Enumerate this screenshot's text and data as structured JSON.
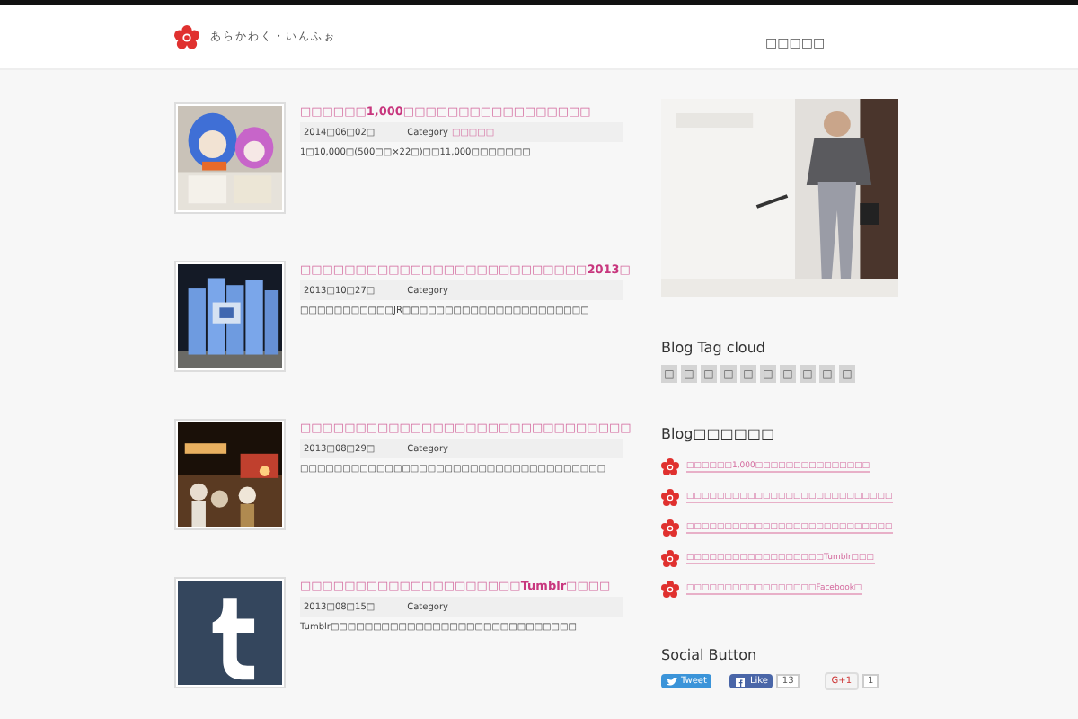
{
  "header": {
    "site_name": "あらかわく・いんふぉ",
    "nav": [
      {
        "label": "□□□□□"
      }
    ]
  },
  "posts": [
    {
      "title": "□□□□□□**1,000**□□□□□□□□□□□□□□□□□",
      "date": "2014□06□02□",
      "category_label": "Category",
      "category": "□□□□□",
      "excerpt": "1□10,000□(500□□×22□)□□11,000□□□□□□□"
    },
    {
      "title": "□□□□□□□□□□□□□□□□□□□□□□□□□□**2013**□",
      "date": "2013□10□27□",
      "category_label": "Category",
      "excerpt": "□□□□□□□□□□□JR□□□□□□□□□□□□□□□□□□□□□□"
    },
    {
      "title": "□□□□□□□□□□□□□□□□□□□□□□□□□□□□□□",
      "date": "2013□08□29□",
      "category_label": "Category",
      "excerpt": "□□□□□□□□□□□□□□□□□□□□□□□□□□□□□□□□□□□□"
    },
    {
      "title": "□□□□□□□□□□□□□□□□□□□□**Tumblr**□□□□",
      "date": "2013□08□15□",
      "category_label": "Category",
      "excerpt": "Tumblr□□□□□□□□□□□□□□□□□□□□□□□□□□□□□"
    }
  ],
  "sidebar": {
    "tag_cloud": {
      "title": "Blog Tag cloud",
      "tags": [
        "□",
        "□",
        "□",
        "□",
        "□",
        "□",
        "□",
        "□",
        "□",
        "□"
      ]
    },
    "recent": {
      "title": "Blog□□□□□□",
      "items": [
        "□□□□□□1,000□□□□□□□□□□□□□□□",
        "□□□□□□□□□□□□□□□□□□□□□□□□□□□",
        "□□□□□□□□□□□□□□□□□□□□□□□□□□□",
        "□□□□□□□□□□□□□□□□□□Tumblr□□□",
        "□□□□□□□□□□□□□□□□□Facebook□"
      ]
    },
    "social": {
      "title": "Social Button",
      "tweet": "Tweet",
      "like": "Like",
      "like_count": "13",
      "gplus": "G+1",
      "gplus_count": "1"
    }
  }
}
